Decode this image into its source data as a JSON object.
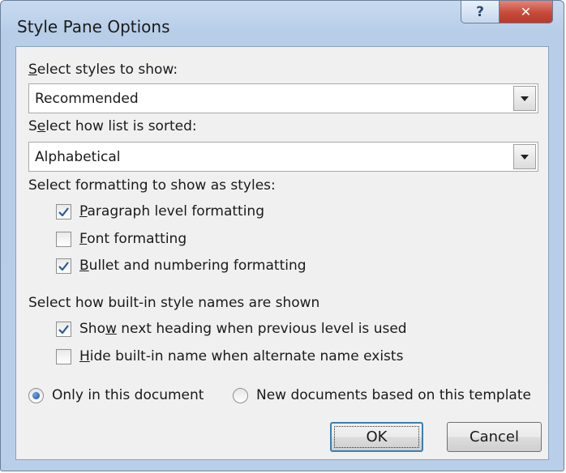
{
  "dialog": {
    "title": "Style Pane Options",
    "help_glyph": "?",
    "close_glyph": "✕"
  },
  "styles_to_show": {
    "label_prefix": "",
    "label_key": "S",
    "label_rest": "elect styles to show:",
    "value": "Recommended"
  },
  "sort_order": {
    "label_prefix": "S",
    "label_key": "e",
    "label_rest": "lect how list is sorted:",
    "value": "Alphabetical"
  },
  "formatting": {
    "heading": "Select formatting to show as styles:",
    "options": [
      {
        "key": "P",
        "rest": "aragraph level formatting",
        "checked": true
      },
      {
        "key": "F",
        "rest": "ont formatting",
        "checked": false
      },
      {
        "key": "B",
        "rest": "ullet and numbering formatting",
        "checked": true
      }
    ]
  },
  "builtin_names": {
    "heading": "Select how built-in style names are shown",
    "options": [
      {
        "prefix": "Sho",
        "key": "w",
        "rest": " next heading when previous level is used",
        "checked": true
      },
      {
        "prefix": "",
        "key": "H",
        "rest": "ide built-in name when alternate name exists",
        "checked": false
      }
    ]
  },
  "scope": {
    "option1": "Only in this document",
    "option1_selected": true,
    "option2": "New documents based on this template",
    "option2_selected": false
  },
  "buttons": {
    "ok": "OK",
    "cancel": "Cancel"
  }
}
